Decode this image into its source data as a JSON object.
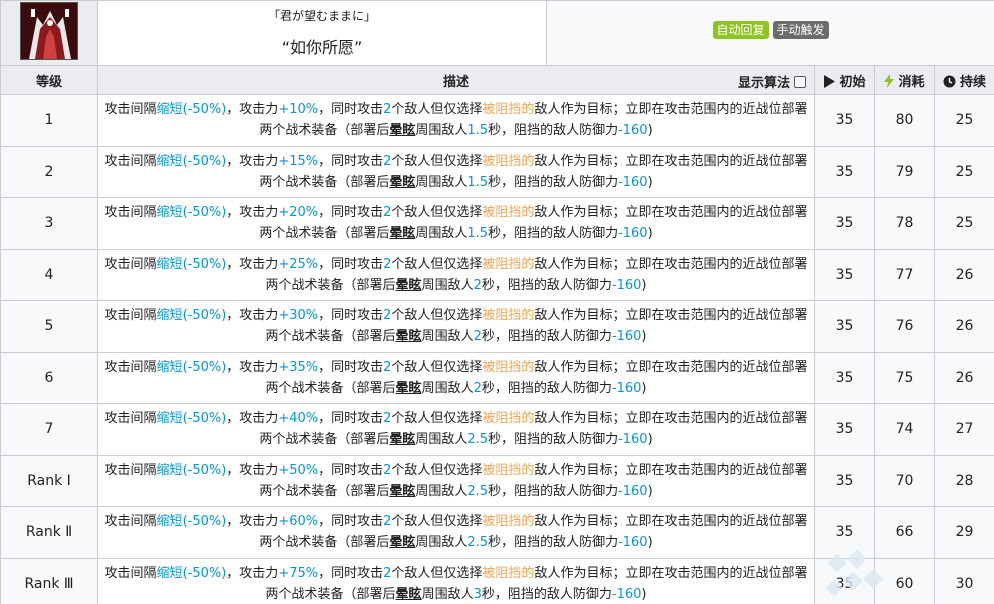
{
  "skill": {
    "icon": "skill-icon",
    "name_jp": "「君が望むままに」",
    "name_cn": "“如你所愿”",
    "tags": [
      {
        "label": "自动回复",
        "color": "#8fc31f"
      },
      {
        "label": "手动触发",
        "color": "#6b6b6b"
      }
    ]
  },
  "columns": {
    "level": "等级",
    "description": "描述",
    "show_formula": "显示算法",
    "initial": "初始",
    "cost": "消耗",
    "duration": "持续"
  },
  "description_parts": {
    "p1": "攻击间隔",
    "shorten": "缩短",
    "interval_val": "(-50%)",
    "p2": "，攻击力",
    "p3": "，同时攻击",
    "targets": "2",
    "p4": "个敌人但仅选择",
    "blocked": "被阻挡的",
    "p5": "敌人作为目标；立即在攻击范围内的近战位部署两个战术装备（部署后",
    "stun": "晕眩",
    "p6": "周围敌人",
    "p7": "秒，阻挡的敌人防御力",
    "def_val": "-160",
    "p8": ")"
  },
  "rows": [
    {
      "level": "1",
      "atk": "+10%",
      "stun_sec": "1.5",
      "initial": "35",
      "cost": "80",
      "duration": "25"
    },
    {
      "level": "2",
      "atk": "+15%",
      "stun_sec": "1.5",
      "initial": "35",
      "cost": "79",
      "duration": "25"
    },
    {
      "level": "3",
      "atk": "+20%",
      "stun_sec": "1.5",
      "initial": "35",
      "cost": "78",
      "duration": "25"
    },
    {
      "level": "4",
      "atk": "+25%",
      "stun_sec": "2",
      "initial": "35",
      "cost": "77",
      "duration": "26"
    },
    {
      "level": "5",
      "atk": "+30%",
      "stun_sec": "2",
      "initial": "35",
      "cost": "76",
      "duration": "26"
    },
    {
      "level": "6",
      "atk": "+35%",
      "stun_sec": "2",
      "initial": "35",
      "cost": "75",
      "duration": "26"
    },
    {
      "level": "7",
      "atk": "+40%",
      "stun_sec": "2.5",
      "initial": "35",
      "cost": "74",
      "duration": "27"
    },
    {
      "level": "Rank Ⅰ",
      "atk": "+50%",
      "stun_sec": "2.5",
      "initial": "35",
      "cost": "70",
      "duration": "28"
    },
    {
      "level": "Rank Ⅱ",
      "atk": "+60%",
      "stun_sec": "2.5",
      "initial": "35",
      "cost": "66",
      "duration": "29"
    },
    {
      "level": "Rank Ⅲ",
      "atk": "+75%",
      "stun_sec": "3",
      "initial": "35",
      "cost": "60",
      "duration": "30"
    }
  ],
  "colors": {
    "blue": "#0098dc",
    "orange": "#f7a452",
    "header_bg": "#eaecf0",
    "cell_bg": "#f8f9fa",
    "border": "#c8ccd1"
  }
}
